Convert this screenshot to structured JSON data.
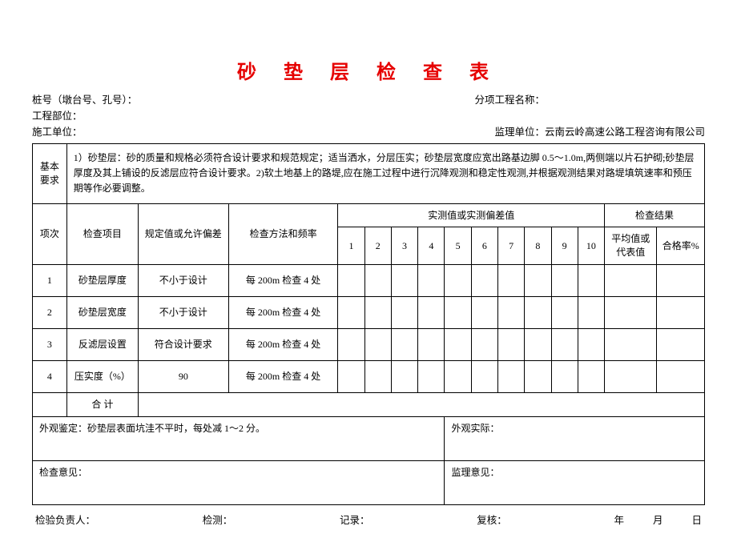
{
  "title": "砂 垫 层 检 查 表",
  "header": {
    "pile_label": "桩号（墩台号、孔号）：",
    "subproject_label": "分项工程名称：",
    "part_label": "工程部位：",
    "constructor_label": "施工单位：",
    "supervisor_label": "监理单位：",
    "supervisor_value": "云南云岭高速公路工程咨询有限公司"
  },
  "requirements": {
    "label": "基本要求",
    "text": "1）砂垫层：砂的质量和规格必须符合设计要求和规范规定；适当洒水，分层压实；砂垫层宽度应宽出路基边脚 0.5～1.0m,两侧端以片石护砌;砂垫层厚度及其上铺设的反滤层应符合设计要求。2)软土地基上的路堤,应在施工过程中进行沉降观测和稳定性观测,并根据观测结果对路堤填筑速率和预压期等作必要调整。"
  },
  "table": {
    "head": {
      "item_no": "项次",
      "check_item": "检查项目",
      "spec_tolerance": "规定值或允许偏差",
      "method_freq": "检查方法和频率",
      "measured_group": "实测值或实测偏差值",
      "result_group": "检查结果",
      "cols": [
        "1",
        "2",
        "3",
        "4",
        "5",
        "6",
        "7",
        "8",
        "9",
        "10"
      ],
      "avg_value": "平均值或代表值",
      "pass_rate": "合格率%"
    },
    "rows": [
      {
        "no": "1",
        "item": "砂垫层厚度",
        "spec": "不小于设计",
        "method": "每 200m 检查 4 处"
      },
      {
        "no": "2",
        "item": "砂垫层宽度",
        "spec": "不小于设计",
        "method": "每 200m 检查 4 处"
      },
      {
        "no": "3",
        "item": "反滤层设置",
        "spec": "符合设计要求",
        "method": "每 200m 检查 4 处"
      },
      {
        "no": "4",
        "item": "压实度（%）",
        "spec": "90",
        "method": "每 200m 检查 4 处"
      }
    ],
    "total_label": "合  计"
  },
  "bottom": {
    "appearance_judge": "外观鉴定：砂垫层表面坑洼不平时，每处减 1～2 分。",
    "appearance_actual": "外观实际：",
    "check_opinion": "检查意见：",
    "supervise_opinion": "监理意见："
  },
  "footer": {
    "inspector_lead": "检验负责人：",
    "inspect": "检测：",
    "record": "记录：",
    "review": "复核：",
    "year": "年",
    "month": "月",
    "day": "日"
  }
}
